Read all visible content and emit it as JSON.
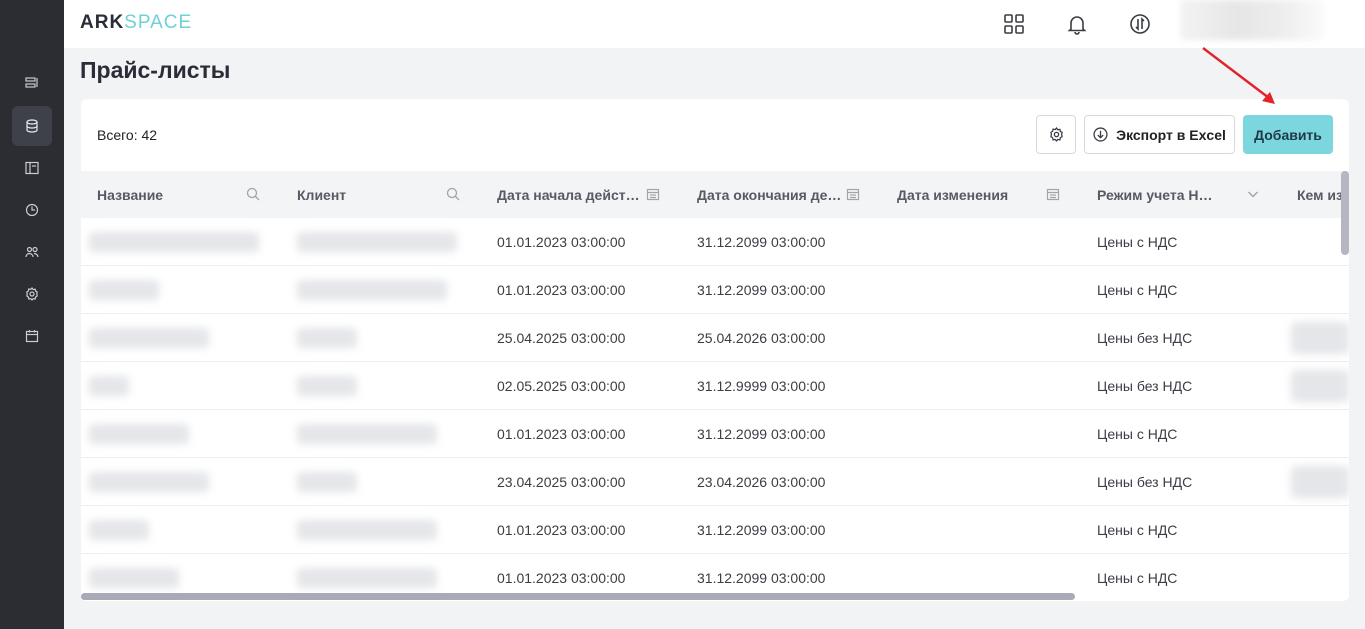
{
  "app": {
    "logo_ark": "ARK",
    "logo_space": "SPACE"
  },
  "sidebar": {
    "items": [
      {
        "icon": "list-icon",
        "active": false
      },
      {
        "icon": "database-icon",
        "active": true
      },
      {
        "icon": "layout-icon",
        "active": false
      },
      {
        "icon": "clock-icon",
        "active": false
      },
      {
        "icon": "users-icon",
        "active": false
      },
      {
        "icon": "gear-icon",
        "active": false
      },
      {
        "icon": "calendar-icon",
        "active": false
      }
    ]
  },
  "topbar": {
    "icons": [
      "grid-apps-icon",
      "bell-icon",
      "exchange-icon"
    ]
  },
  "page": {
    "title": "Прайс-листы",
    "total": "Всего: 42",
    "export_label": "Экспорт в Excel",
    "add_label": "Добавить"
  },
  "table": {
    "columns": [
      "Название",
      "Клиент",
      "Дата начала действ…",
      "Дата окончания дей…",
      "Дата изменения",
      "Режим учета Н…",
      "Кем из"
    ],
    "rows": [
      {
        "start": "01.01.2023 03:00:00",
        "end": "31.12.2099 03:00:00",
        "mode": "Цены с НДС"
      },
      {
        "start": "01.01.2023 03:00:00",
        "end": "31.12.2099 03:00:00",
        "mode": "Цены с НДС"
      },
      {
        "start": "25.04.2025 03:00:00",
        "end": "25.04.2026 03:00:00",
        "mode": "Цены без НДС"
      },
      {
        "start": "02.05.2025 03:00:00",
        "end": "31.12.9999 03:00:00",
        "mode": "Цены без НДС"
      },
      {
        "start": "01.01.2023 03:00:00",
        "end": "31.12.2099 03:00:00",
        "mode": "Цены с НДС"
      },
      {
        "start": "23.04.2025 03:00:00",
        "end": "23.04.2026 03:00:00",
        "mode": "Цены без НДС"
      },
      {
        "start": "01.01.2023 03:00:00",
        "end": "31.12.2099 03:00:00",
        "mode": "Цены с НДС"
      },
      {
        "start": "01.01.2023 03:00:00",
        "end": "31.12.2099 03:00:00",
        "mode": "Цены с НДС"
      }
    ]
  },
  "colors": {
    "sidebar_bg": "#2b2d33",
    "accent": "#7bd6dd",
    "annotation_arrow": "#e0242a"
  }
}
